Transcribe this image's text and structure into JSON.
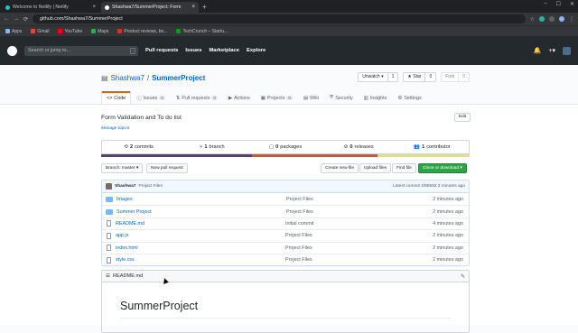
{
  "browser": {
    "tabs": [
      {
        "title": "Welcome to Netlify | Netlify",
        "active": false,
        "favicon_color": "#20c6b7"
      },
      {
        "title": "Shashwa7/SummerProject: Form",
        "active": true,
        "favicon_color": "#ffffff"
      }
    ],
    "new_tab": "+",
    "address": "github.com/Shashwa7/SummerProject",
    "address_overlay": "Welcome to Netlify | Netlify",
    "bookmarks": [
      {
        "label": "Apps",
        "color": "#8ab4f8"
      },
      {
        "label": "Gmail",
        "color": "#ea4335"
      },
      {
        "label": "YouTube",
        "color": "#ff0000"
      },
      {
        "label": "Maps",
        "color": "#34a853"
      },
      {
        "label": "Product reviews, bo...",
        "color": "#d93025"
      },
      {
        "label": "TechCrunch – Startu...",
        "color": "#0a9e01"
      }
    ]
  },
  "gh_header": {
    "search_placeholder": "Search or jump to...",
    "search_key": "/",
    "nav": [
      "Pull requests",
      "Issues",
      "Marketplace",
      "Explore"
    ],
    "bell": "🔔",
    "plus": "+▾"
  },
  "repo": {
    "owner": "Shashwa7",
    "separator": "/",
    "name": "SummerProject",
    "watch": {
      "label": "Unwatch ▾",
      "count": "1"
    },
    "star": {
      "label": "★ Star",
      "count": "0"
    },
    "fork": {
      "label": "Fork",
      "count": "0"
    },
    "tabs": [
      {
        "label": "Code",
        "count": "",
        "icon": "<>",
        "selected": true
      },
      {
        "label": "Issues",
        "count": "0",
        "icon": "ⓘ",
        "selected": false
      },
      {
        "label": "Pull requests",
        "count": "0",
        "icon": "⇅",
        "selected": false
      },
      {
        "label": "Actions",
        "count": "",
        "icon": "▶",
        "selected": false
      },
      {
        "label": "Projects",
        "count": "0",
        "icon": "▦",
        "selected": false
      },
      {
        "label": "Wiki",
        "count": "",
        "icon": "▤",
        "selected": false
      },
      {
        "label": "Security",
        "count": "",
        "icon": "⛨",
        "selected": false
      },
      {
        "label": "Insights",
        "count": "",
        "icon": "▥",
        "selected": false
      },
      {
        "label": "Settings",
        "count": "",
        "icon": "⚙",
        "selected": false
      }
    ]
  },
  "about": {
    "description": "Form Validation and To do list",
    "manage_topics": "Manage topics",
    "edit": "Edit"
  },
  "summary": [
    {
      "icon": "⟲",
      "count": "2",
      "label": "commits"
    },
    {
      "icon": "⑂",
      "count": "1",
      "label": "branch"
    },
    {
      "icon": "▢",
      "count": "0",
      "label": "packages"
    },
    {
      "icon": "⊘",
      "count": "0",
      "label": "releases"
    },
    {
      "icon": "👥",
      "count": "1",
      "label": "contributor"
    }
  ],
  "languages": [
    {
      "color": "#563d7c",
      "percent": 41
    },
    {
      "color": "#e34c26",
      "percent": 34
    },
    {
      "color": "#f1e05a",
      "percent": 25
    }
  ],
  "toolbar": {
    "branch": "Branch: master ▾",
    "new_pr": "New pull request",
    "create": "Create new file",
    "upload": "Upload files",
    "find": "Find file",
    "clone": "Clone or download ▾"
  },
  "commit": {
    "author": "Shashwa7",
    "message": "Project Files",
    "latest": "Latest commit 1f86582 2 minutes ago"
  },
  "files": [
    {
      "type": "dir",
      "name": "Images",
      "message": "Project Files",
      "age": "2 minutes ago"
    },
    {
      "type": "dir",
      "name": "Summer Project",
      "message": "Project Files",
      "age": "2 minutes ago"
    },
    {
      "type": "file",
      "name": "README.md",
      "message": "Initial commit",
      "age": "4 minutes ago"
    },
    {
      "type": "file",
      "name": "app.js",
      "message": "Project Files",
      "age": "2 minutes ago"
    },
    {
      "type": "file",
      "name": "index.html",
      "message": "Project Files",
      "age": "2 minutes ago"
    },
    {
      "type": "file",
      "name": "style.css",
      "message": "Project Files",
      "age": "2 minutes ago"
    }
  ],
  "readme": {
    "filename": "README.md",
    "heading": "SummerProject"
  }
}
